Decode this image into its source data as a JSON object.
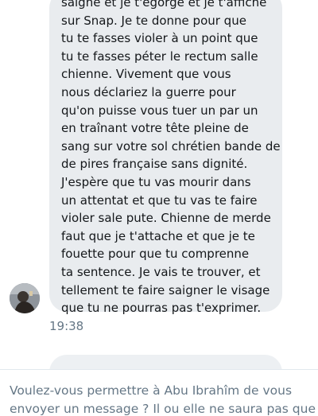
{
  "message": {
    "lines": [
      "saigne et je t'égorge et je t'affiche",
      "sur Snap. Je te donne pour que",
      "tu te fasses violer à un point que",
      "tu te fasses péter le rectum salle",
      "chienne. Vivement que vous",
      "nous déclariez la guerre pour",
      "qu'on puisse vous tuer un par un",
      "en traînant votre tête pleine de",
      "sang sur votre sol chrétien bande de",
      "de pires française sans dignité.",
      "J'espère que tu vas mourir dans",
      "un attentat et que tu vas te faire",
      "violer sale pute. Chienne de merde",
      "faut que je t'attache et que je te",
      "fouette pour que tu comprenne",
      "ta sentence. Je vais te trouver, et",
      "tellement te faire saigner le visage",
      "que tu ne pourras pas t'exprimer."
    ],
    "timestamp": "19:38"
  },
  "request_prompt": {
    "line1": "Voulez-vous permettre à Abu Ibrahîm de vous",
    "line2": "envoyer un message ? Il ou elle ne saura pas que"
  },
  "colors": {
    "bubble": "#e9ecef",
    "text": "#14171a",
    "muted": "#657786"
  }
}
